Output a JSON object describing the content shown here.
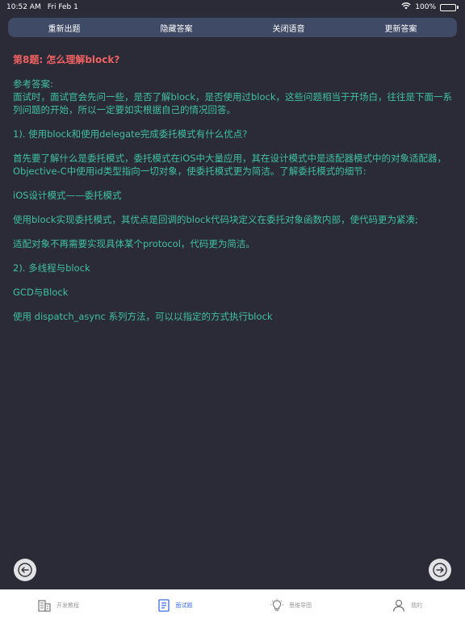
{
  "status_bar": {
    "time": "10:52 AM",
    "date": "Fri Feb 1",
    "battery": "100%"
  },
  "toolbar": {
    "buttons": [
      "重新出题",
      "隐藏答案",
      "关闭语音",
      "更新答案"
    ]
  },
  "question": {
    "title": "第8题: 怎么理解block?",
    "paragraphs": [
      "参考答案:\n面试时，面试官会先问一些，是否了解block，是否使用过block，这些问题相当于开场白，往往是下面一系列问题的开始，所以一定要如实根据自己的情况回答。",
      "1). 使用block和使用delegate完成委托模式有什么优点?",
      "首先要了解什么是委托模式，委托模式在iOS中大量应用，其在设计模式中是适配器模式中的对象适配器，Objective-C中使用id类型指向一切对象，使委托模式更为简洁。了解委托模式的细节:",
      "iOS设计模式——委托模式",
      "使用block实现委托模式，其优点是回调的block代码块定义在委托对象函数内部，使代码更为紧凑;",
      "适配对象不再需要实现具体某个protocol，代码更为简洁。",
      "2). 多线程与block",
      "GCD与Block",
      "使用 dispatch_async 系列方法，可以以指定的方式执行block"
    ]
  },
  "nav": {
    "prev_icon": "arrow-left-icon",
    "next_icon": "arrow-right-icon"
  },
  "tabs": [
    {
      "label": "开发教程",
      "icon": "building-icon",
      "active": false
    },
    {
      "label": "面试题",
      "icon": "document-icon",
      "active": true
    },
    {
      "label": "思维导图",
      "icon": "lightbulb-icon",
      "active": false
    },
    {
      "label": "我的",
      "icon": "user-icon",
      "active": false
    }
  ],
  "colors": {
    "background": "#2b2a37",
    "toolbar": "#3f4a66",
    "title": "#f06262",
    "text": "#3fc1a2",
    "tab_active": "#3b6de0",
    "tab_inactive": "#9a9a9a"
  }
}
